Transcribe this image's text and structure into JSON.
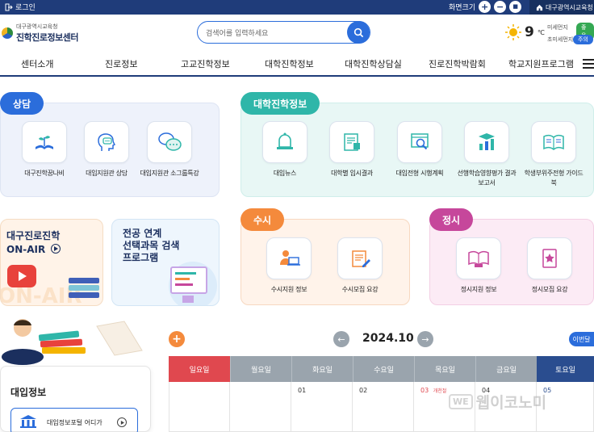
{
  "topbar": {
    "login": "로그인",
    "zoom_label": "화면크기",
    "zoom_in": "+",
    "zoom_out": "−",
    "zoom_reset": "■",
    "office": "대구광역시교육청"
  },
  "header": {
    "org": "대구광역시교육청",
    "site_title": "진학진로정보센터",
    "search_placeholder": "검색어를 입력하세요",
    "temperature": "9",
    "temp_unit": "℃",
    "dust_fine_label": "미세먼지",
    "dust_fine_value": "좋음",
    "dust_ultra_label": "초미세먼지",
    "dust_ultra_value": "주의"
  },
  "nav": [
    "센터소개",
    "진로정보",
    "고교진학정보",
    "대학진학정보",
    "대학진학상담실",
    "진로진학박람회",
    "학교지원프로그램"
  ],
  "consult": {
    "tag": "상담",
    "items": [
      {
        "label": "대구진학꿈나비",
        "icon": "book-plant-icon"
      },
      {
        "label": "대입지원관 상담",
        "icon": "head-chat-icon"
      },
      {
        "label": "대입지원관 소그룹특강",
        "icon": "chat-bubbles-icon"
      }
    ]
  },
  "college": {
    "tag": "대학진학정보",
    "items": [
      {
        "label": "대입뉴스",
        "icon": "bell-icon"
      },
      {
        "label": "대학별 입시결과",
        "icon": "document-chart-icon"
      },
      {
        "label": "대입전형 시행계획",
        "icon": "magnifier-doc-icon"
      },
      {
        "label": "선행학습영향평가 결과보고서",
        "icon": "graduation-chart-icon"
      },
      {
        "label": "학생부위주전형 가이드북",
        "icon": "open-book-icon"
      }
    ]
  },
  "onair": {
    "title": "대구진로진학\nON-AIR",
    "watermark": "ON-AIR"
  },
  "program": {
    "title": "전공 연계\n선택과목 검색\n프로그램"
  },
  "susi": {
    "tag": "수시",
    "items": [
      {
        "label": "수시지원 정보",
        "icon": "person-laptop-icon"
      },
      {
        "label": "수시모집 요강",
        "icon": "pencil-doc-icon"
      }
    ]
  },
  "jeongsi": {
    "tag": "정시",
    "items": [
      {
        "label": "정시지원 정보",
        "icon": "reader-book-icon"
      },
      {
        "label": "정시모집 요강",
        "icon": "star-book-icon"
      }
    ]
  },
  "admission": {
    "title": "대입정보",
    "link": "대입정보포털 어디가"
  },
  "calendar": {
    "month": "2024.10",
    "add": "+",
    "prev": "←",
    "next": "→",
    "this_month": "이번달",
    "days": [
      "일요일",
      "월요일",
      "화요일",
      "수요일",
      "목요일",
      "금요일",
      "토요일"
    ],
    "first_week": [
      "",
      "",
      "01",
      "02",
      "03",
      "04",
      "05"
    ],
    "holiday_note": "개천절"
  },
  "watermark": {
    "we": "WE",
    "text": "웹이코노미"
  },
  "colors": {
    "navy": "#1f3c7a",
    "blue": "#2b6ddb",
    "teal": "#2fb6a9",
    "orange": "#f48a3c",
    "pink": "#c6479b",
    "sunday": "#e0484f",
    "saturday": "#2a4d8f"
  }
}
